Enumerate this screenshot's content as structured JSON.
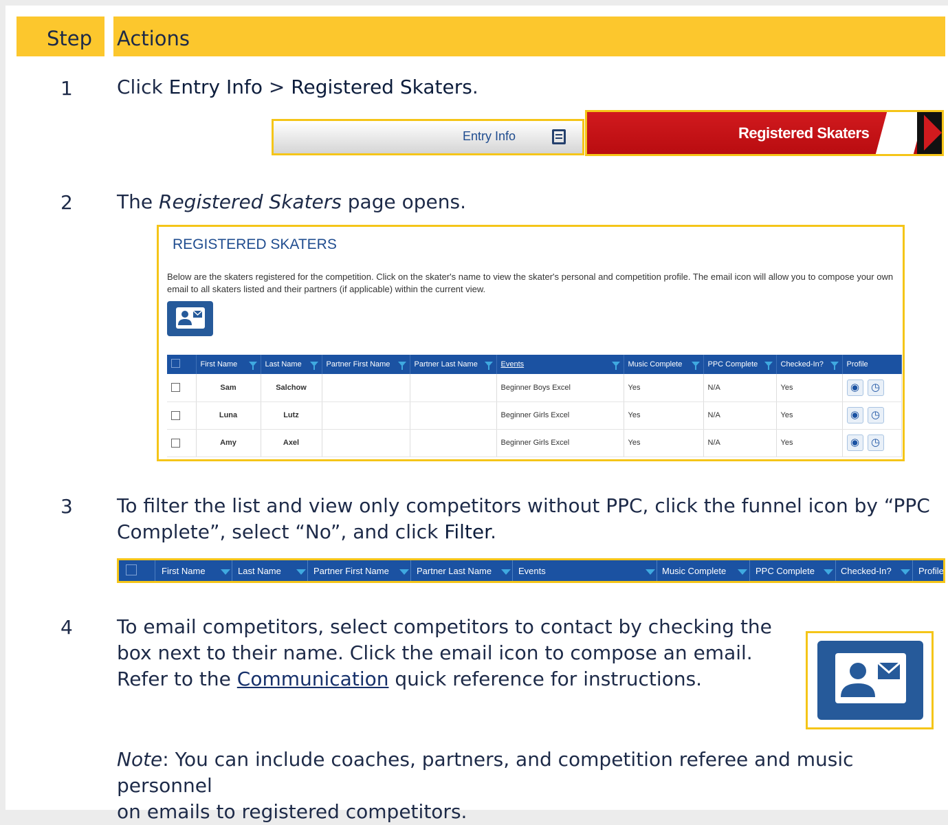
{
  "header": {
    "step": "Step",
    "actions": "Actions"
  },
  "steps": [
    {
      "number": "1",
      "text_parts": [
        "Click ",
        "Entry Info",
        " > ",
        "Registered Skaters",
        "."
      ],
      "entry_info_label": "Entry Info",
      "registered_skaters_label": "Registered Skaters"
    },
    {
      "number": "2",
      "text_parts": [
        "The ",
        "Registered Skaters",
        " page opens."
      ],
      "panel": {
        "title": "REGISTERED SKATERS",
        "description": "Below are the skaters registered for the competition. Click on the skater's name to view the skater's personal and competition profile. The email icon will allow you to compose your own email to all skaters listed and their partners (if applicable) within the current view.",
        "columns": [
          "First Name",
          "Last Name",
          "Partner First Name",
          "Partner Last Name",
          "Events",
          "Music Complete",
          "PPC Complete",
          "Checked-In?",
          "Profile"
        ],
        "rows": [
          {
            "first": "Sam",
            "last": "Salchow",
            "pfirst": "",
            "plast": "",
            "event": "Beginner Boys Excel",
            "music": "Yes",
            "ppc": "N/A",
            "checked": "Yes"
          },
          {
            "first": "Luna",
            "last": "Lutz",
            "pfirst": "",
            "plast": "",
            "event": "Beginner Girls Excel",
            "music": "Yes",
            "ppc": "N/A",
            "checked": "Yes"
          },
          {
            "first": "Amy",
            "last": "Axel",
            "pfirst": "",
            "plast": "",
            "event": "Beginner Girls Excel",
            "music": "Yes",
            "ppc": "N/A",
            "checked": "Yes"
          }
        ]
      }
    },
    {
      "number": "3",
      "text_line1": "To filter the list and view only competitors without PPC, click the funnel icon by “PPC",
      "text_line2_a": "Complete”, select “No”, and click ",
      "text_line2_b": "Filter",
      "text_line2_c": ".",
      "bar_columns": [
        "First Name",
        "Last Name",
        "Partner First Name",
        "Partner Last Name",
        "Events",
        "Music Complete",
        "PPC Complete",
        "Checked-In?",
        "Profile"
      ]
    },
    {
      "number": "4",
      "line1": "To email competitors, select competitors to contact by checking the",
      "line2": "box next to their name.  Click the email icon to compose an email.",
      "line3_a": "Refer to the ",
      "line3_link": "Communication",
      "line3_b": " quick reference for instructions.",
      "note_label": "Note",
      "note_line1": ":  You can include coaches, partners, and competition referee and music personnel",
      "note_line2": "on emails to registered competitors."
    }
  ],
  "colors": {
    "header": "#fcc72d",
    "highlight": "#f5c518",
    "grid_header": "#1b52a2",
    "red_banner": "#d11a1e"
  },
  "icons": [
    "calendar-icon",
    "email-contact-icon",
    "funnel-icon",
    "map-pin-icon",
    "clock-icon",
    "play-arrow-icon"
  ]
}
